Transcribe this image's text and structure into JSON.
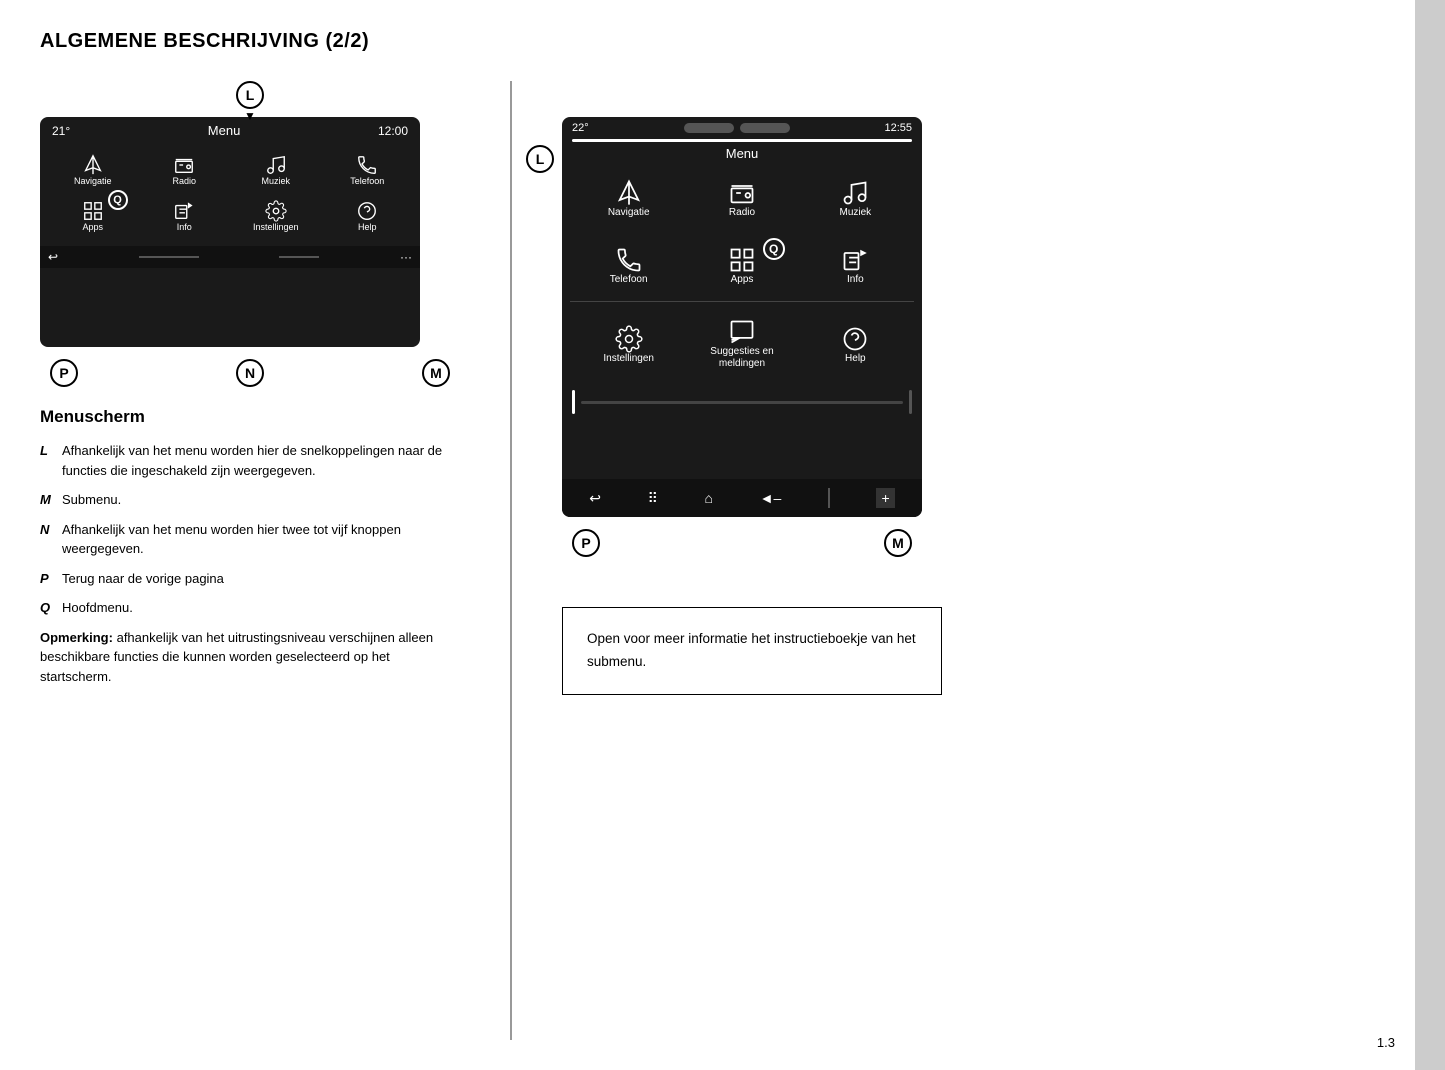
{
  "page": {
    "title": "ALGEMENE BESCHRIJVING (2/2)",
    "page_number": "1.3"
  },
  "left_screen": {
    "temp": "21°",
    "time": "12:00",
    "menu_label": "Menu",
    "icons": [
      {
        "id": "navigatie",
        "label": "Navigatie"
      },
      {
        "id": "radio",
        "label": "Radio"
      },
      {
        "id": "muziek",
        "label": "Muziek"
      },
      {
        "id": "telefoon",
        "label": "Telefoon"
      },
      {
        "id": "apps",
        "label": "Apps"
      },
      {
        "id": "info",
        "label": "Info"
      },
      {
        "id": "instellingen",
        "label": "Instellingen"
      },
      {
        "id": "help",
        "label": "Help"
      }
    ],
    "footer": {
      "back": "↩",
      "dots": "···"
    },
    "labels": {
      "p": "P",
      "n": "N",
      "m": "M",
      "l": "L"
    }
  },
  "right_screen": {
    "temp": "22°",
    "time": "12:55",
    "menu_label": "Menu",
    "icons": [
      {
        "id": "navigatie",
        "label": "Navigatie"
      },
      {
        "id": "radio",
        "label": "Radio"
      },
      {
        "id": "muziek",
        "label": "Muziek"
      },
      {
        "id": "telefoon",
        "label": "Telefoon"
      },
      {
        "id": "apps",
        "label": "Apps"
      },
      {
        "id": "info",
        "label": "Info"
      },
      {
        "id": "instellingen",
        "label": "Instellingen"
      },
      {
        "id": "suggesties",
        "label": "Suggesties en meldingen"
      },
      {
        "id": "help",
        "label": "Help"
      }
    ],
    "labels": {
      "p": "P",
      "m": "M",
      "l": "L"
    }
  },
  "section_title": "Menuscherm",
  "descriptions": [
    {
      "key": "L",
      "text": "Afhankelijk van het menu worden hier de snelkoppelingen naar de functies die ingeschakeld zijn weergegeven."
    },
    {
      "key": "M",
      "text": "Submenu."
    },
    {
      "key": "N",
      "text": "Afhankelijk van het menu worden hier twee tot vijf knoppen weergegeven."
    },
    {
      "key": "P",
      "text": "Terug naar de vorige pagina"
    },
    {
      "key": "Q",
      "text": "Hoofdmenu."
    }
  ],
  "opmerking": {
    "label": "Opmerking:",
    "text": "afhankelijk van het uitrustingsniveau verschijnen alleen beschikbare functies die kunnen worden geselecteerd op het startscherm."
  },
  "info_box": {
    "text": "Open voor meer informatie het instructieboekje van het submenu."
  }
}
